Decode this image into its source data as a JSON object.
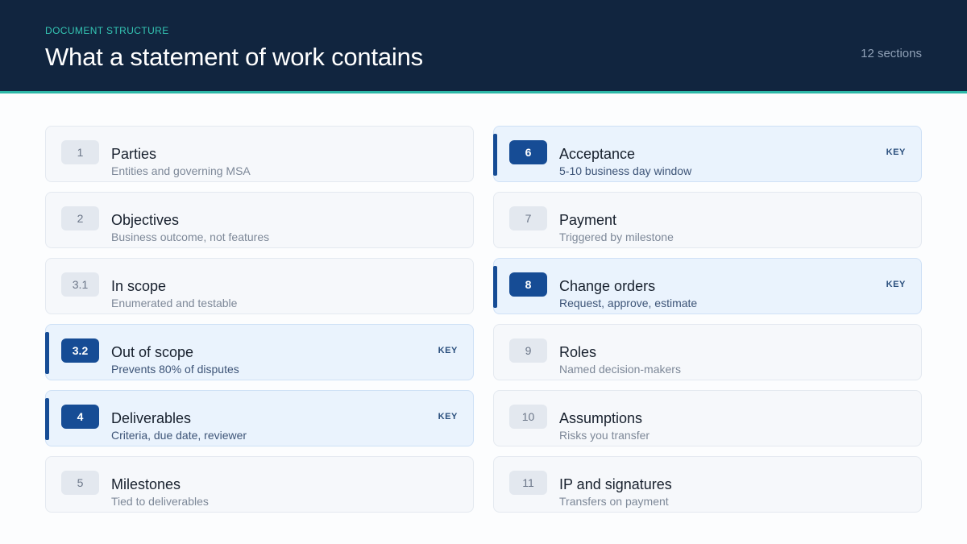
{
  "header": {
    "eyebrow": "DOCUMENT STRUCTURE",
    "title": "What a statement of work contains",
    "count": "12 sections"
  },
  "key_label": "KEY",
  "colors": {
    "header_bg": "#11253f",
    "header_rule": "#2db8a8",
    "key_accent": "#164c95"
  },
  "sections": [
    {
      "num": "1",
      "title": "Parties",
      "sub": "Entities and governing MSA",
      "key": false
    },
    {
      "num": "2",
      "title": "Objectives",
      "sub": "Business outcome, not features",
      "key": false
    },
    {
      "num": "3.1",
      "title": "In scope",
      "sub": "Enumerated and testable",
      "key": false
    },
    {
      "num": "3.2",
      "title": "Out of scope",
      "sub": "Prevents 80% of disputes",
      "key": true
    },
    {
      "num": "4",
      "title": "Deliverables",
      "sub": "Criteria, due date, reviewer",
      "key": true
    },
    {
      "num": "5",
      "title": "Milestones",
      "sub": "Tied to deliverables",
      "key": false
    },
    {
      "num": "6",
      "title": "Acceptance",
      "sub": "5-10 business day window",
      "key": true
    },
    {
      "num": "7",
      "title": "Payment",
      "sub": "Triggered by milestone",
      "key": false
    },
    {
      "num": "8",
      "title": "Change orders",
      "sub": "Request, approve, estimate",
      "key": true
    },
    {
      "num": "9",
      "title": "Roles",
      "sub": "Named decision-makers",
      "key": false
    },
    {
      "num": "10",
      "title": "Assumptions",
      "sub": "Risks you transfer",
      "key": false
    },
    {
      "num": "11",
      "title": "IP and signatures",
      "sub": "Transfers on payment",
      "key": false
    }
  ]
}
